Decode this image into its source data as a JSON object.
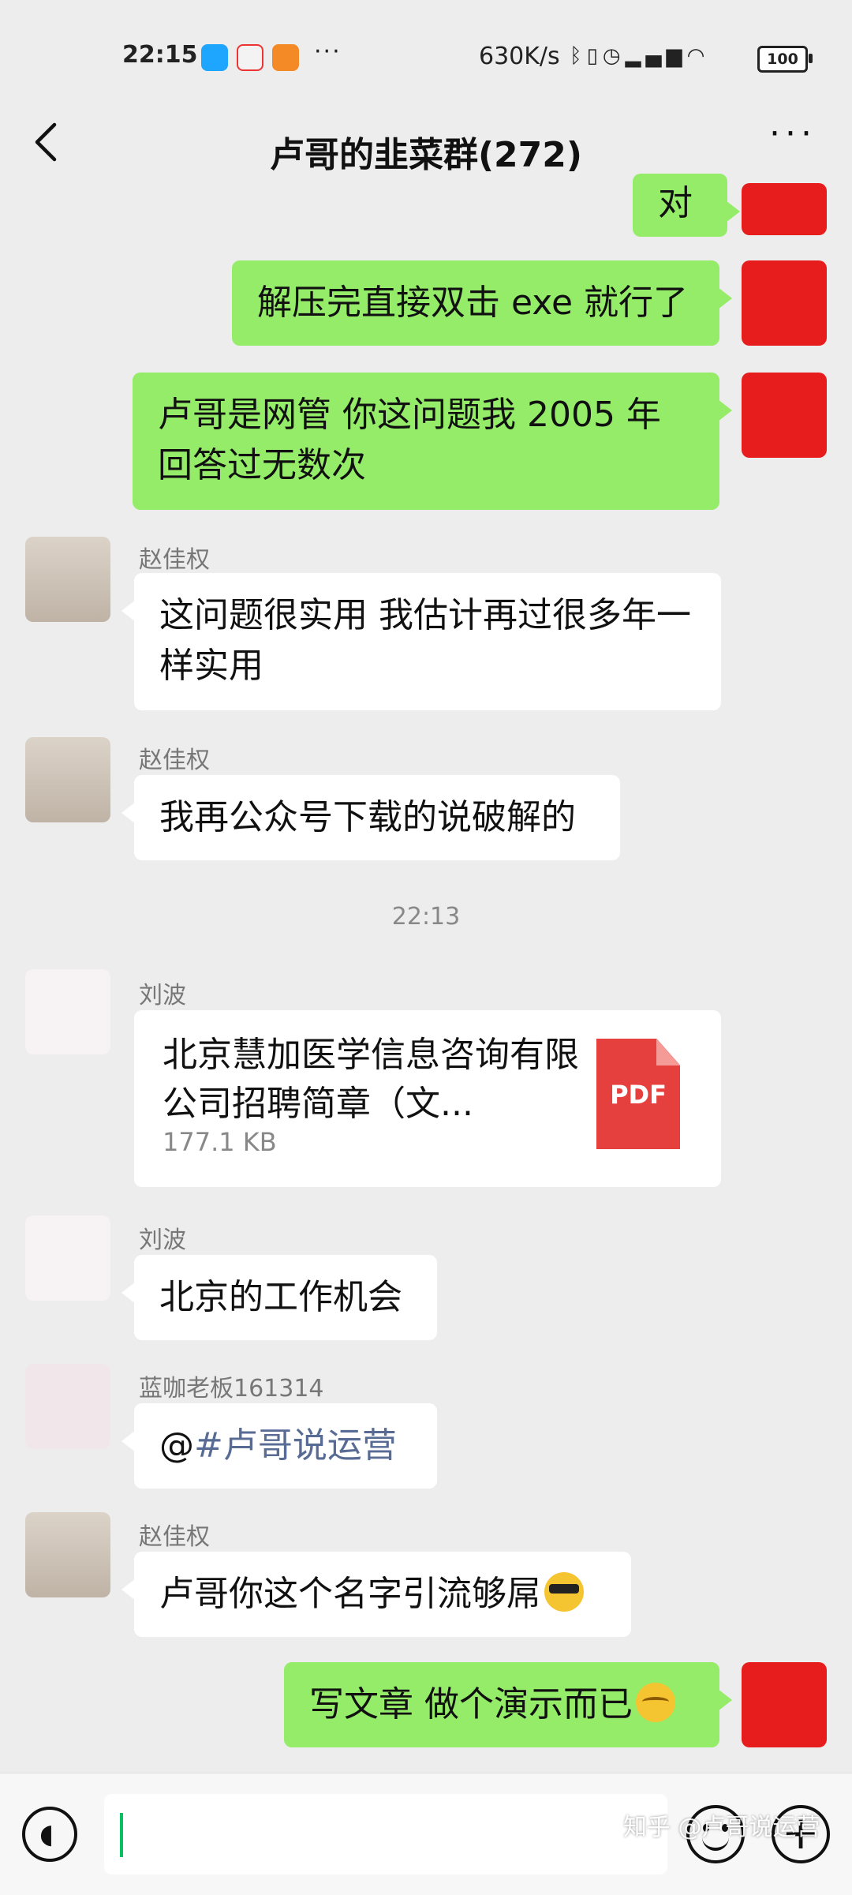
{
  "status_bar": {
    "time": "22:15",
    "notif_dots": "···",
    "net_speed": "630K/s",
    "icons": [
      "bluetooth-icon",
      "vibrate-icon",
      "alarm-icon",
      "signal-icon",
      "sim-icon",
      "wifi-icon"
    ],
    "battery": "100"
  },
  "header": {
    "title": "卢哥的韭菜群(272)",
    "more": "···"
  },
  "messages": [
    {
      "from": "me",
      "text": "对"
    },
    {
      "from": "me",
      "text": "解压完直接双击 exe 就行了"
    },
    {
      "from": "me",
      "text": "卢哥是网管 你这问题我 2005 年回答过无数次"
    },
    {
      "from": "other",
      "sender": "赵佳权",
      "text": "这问题很实用  我估计再过很多年一样实用"
    },
    {
      "from": "other",
      "sender": "赵佳权",
      "text": "我再公众号下载的说破解的"
    },
    {
      "type": "timestamp",
      "text": "22:13"
    },
    {
      "from": "other",
      "sender": "刘波",
      "file": {
        "name": "北京慧加医学信息咨询有限公司招聘简章（文...",
        "size": "177.1 KB",
        "type": "PDF"
      }
    },
    {
      "from": "other",
      "sender": "刘波",
      "text": "北京的工作机会"
    },
    {
      "from": "other",
      "sender": "蓝咖老板161314",
      "prefix": "@",
      "hashtag": "#卢哥说运营"
    },
    {
      "from": "other",
      "sender": "赵佳权",
      "text": "卢哥你这个名字引流够屌"
    },
    {
      "from": "me",
      "text": "写文章 做个演示而已"
    }
  ],
  "input": {
    "value": "",
    "placeholder": ""
  },
  "watermark": "知乎 @卢哥说运营",
  "colors": {
    "my_bubble": "#95ec69",
    "other_bubble": "#ffffff",
    "background": "#ededed",
    "cursor": "#07c160",
    "hashtag": "#576b95"
  }
}
